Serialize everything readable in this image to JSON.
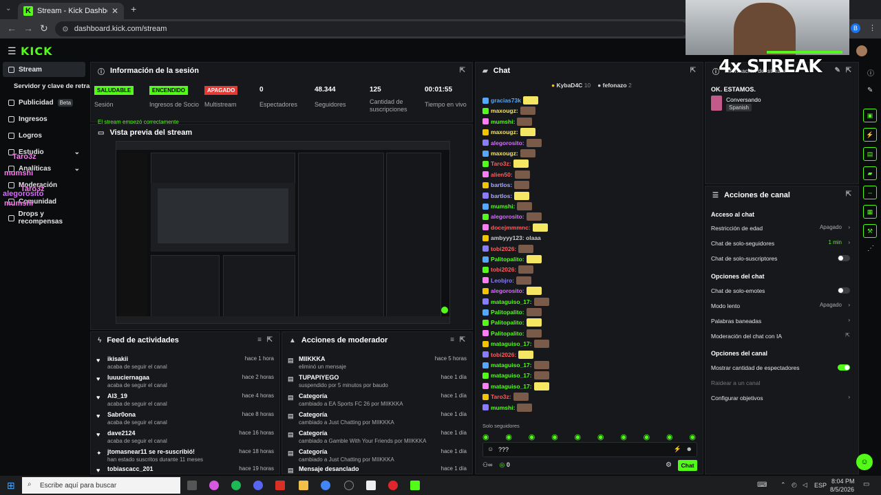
{
  "browser": {
    "tab_title": "Stream - Kick Dashboard",
    "url": "dashboard.kick.com/stream",
    "profile_initial": "B"
  },
  "sidebar": {
    "items": [
      {
        "label": "Stream"
      },
      {
        "label": "Servidor y clave de retransmisión"
      },
      {
        "label": "Publicidad",
        "badge": "Beta"
      },
      {
        "label": "Ingresos"
      },
      {
        "label": "Logros"
      },
      {
        "label": "Estudio"
      },
      {
        "label": "Analíticas"
      },
      {
        "label": "Moderación"
      },
      {
        "label": "Comunidad"
      },
      {
        "label": "Drops y recompensas"
      }
    ]
  },
  "session": {
    "title": "Información de la sesión",
    "stats": [
      {
        "value": "SALUDABLE",
        "label": "Sesión",
        "badge_color": "#53fc18"
      },
      {
        "value": "ENCENDIDO",
        "label": "Ingresos de Socio",
        "badge_color": "#53fc18"
      },
      {
        "value": "APAGADO",
        "label": "Multistream",
        "badge_color": "#e53935"
      },
      {
        "value": "0",
        "label": "Espectadores"
      },
      {
        "value": "48.344",
        "label": "Seguidores"
      },
      {
        "value": "125",
        "label": "Cantidad de suscripciones"
      },
      {
        "value": "00:01:55",
        "label": "Tiempo en vivo"
      }
    ],
    "banner": "El stream empezó correctamente"
  },
  "preview": {
    "title": "Vista previa del stream"
  },
  "feed": {
    "title": "Feed de actividades",
    "rows": [
      {
        "name": "ikisakii",
        "sub": "acaba de seguir el canal",
        "time": "hace 1 hora"
      },
      {
        "name": "luuuciernagaa",
        "sub": "acaba de seguir el canal",
        "time": "hace 2 horas"
      },
      {
        "name": "AI3_19",
        "sub": "acaba de seguir el canal",
        "time": "hace 4 horas"
      },
      {
        "name": "Sabr0ona",
        "sub": "acaba de seguir el canal",
        "time": "hace 8 horas"
      },
      {
        "name": "dave2124",
        "sub": "acaba de seguir el canal",
        "time": "hace 16 horas"
      },
      {
        "name": "jtomasnear11 se re-suscribió!",
        "sub": "han estado suscritos durante 11 meses",
        "time": "hace 18 horas"
      },
      {
        "name": "tobiascacc_201",
        "sub": "",
        "time": "hace 19 horas"
      }
    ]
  },
  "modactions": {
    "title": "Acciones de moderador",
    "rows": [
      {
        "name": "MIIKKKA",
        "sub": "eliminó un mensaje",
        "time": "hace 5 horas"
      },
      {
        "name": "TUPAPIYEGO",
        "sub": "suspendido por 5 minutos por baudo",
        "time": "hace 1 día"
      },
      {
        "name": "Categoría",
        "sub": "cambiado a EA Sports FC 26 por MIIKKKA",
        "time": "hace 1 día"
      },
      {
        "name": "Categoría",
        "sub": "cambiado a Just Chatting por MIIKKKA",
        "time": "hace 1 día"
      },
      {
        "name": "Categoría",
        "sub": "cambiado a Gamble With Your Friends por MIIKKKA",
        "time": "hace 1 día"
      },
      {
        "name": "Categoría",
        "sub": "cambiado a Just Chatting por MIIKKKA",
        "time": "hace 1 día"
      },
      {
        "name": "Mensaje desanclado",
        "sub": "",
        "time": "hace 1 día"
      }
    ]
  },
  "chat": {
    "title": "Chat",
    "pinned_users": [
      {
        "name": "KybaD4C",
        "count": "10"
      },
      {
        "name": "fefonazo",
        "count": "2"
      }
    ],
    "lines": [
      {
        "user": "gracias73k",
        "color": "#53a8ff"
      },
      {
        "user": "maxougz:",
        "color": "#f5e663"
      },
      {
        "user": "mumshi:",
        "color": "#53fc18"
      },
      {
        "user": "maxougz:",
        "color": "#f5e663"
      },
      {
        "user": "alegorosito:",
        "color": "#d770ff"
      },
      {
        "user": "maxougz:",
        "color": "#f5e663"
      },
      {
        "user": "Taro3z:",
        "color": "#ff5e5e"
      },
      {
        "user": "alien50:",
        "color": "#ff5e5e"
      },
      {
        "user": "bartlos:",
        "color": "#aaaaff"
      },
      {
        "user": "bartlos:",
        "color": "#aaaaff"
      },
      {
        "user": "mumshi:",
        "color": "#53fc18"
      },
      {
        "user": "alegorosito:",
        "color": "#d770ff"
      },
      {
        "user": "docejmmmnc:",
        "color": "#ff5e5e"
      },
      {
        "user": "ambyyy123: olaaa",
        "color": "#cccccc"
      },
      {
        "user": "tobi2026:",
        "color": "#ff5e5e"
      },
      {
        "user": "Palitopalito:",
        "color": "#53fc18"
      },
      {
        "user": "tobi2026:",
        "color": "#ff5e5e"
      },
      {
        "user": "Leobjro:",
        "color": "#8a7cff"
      },
      {
        "user": "alegorosito:",
        "color": "#d770ff"
      },
      {
        "user": "mataguiso_17:",
        "color": "#53fc18"
      },
      {
        "user": "Palitopalito:",
        "color": "#53fc18"
      },
      {
        "user": "Palitopalito:",
        "color": "#53fc18"
      },
      {
        "user": "Palitopalito:",
        "color": "#53fc18"
      },
      {
        "user": "mataguiso_17:",
        "color": "#53fc18"
      },
      {
        "user": "tobi2026:",
        "color": "#ff5e5e"
      },
      {
        "user": "mataguiso_17:",
        "color": "#53fc18"
      },
      {
        "user": "mataguiso_17:",
        "color": "#53fc18"
      },
      {
        "user": "mataguiso_17:",
        "color": "#53fc18"
      },
      {
        "user": "Taro3z:",
        "color": "#ff5e5e"
      },
      {
        "user": "mumshi:",
        "color": "#53fc18"
      }
    ],
    "followers_only": "Solo seguidores",
    "input_value": "???",
    "viewer_count": "0",
    "send_label": "Chat"
  },
  "streaminfo": {
    "title": "Información del stream",
    "stream_title": "OK. ESTAMOS.",
    "category": "Conversando",
    "language": "Spanish"
  },
  "actions": {
    "title": "Acciones de canal",
    "chat_access": "Acceso al chat",
    "age_restriction": "Restricción de edad",
    "age_value": "Apagado",
    "followers_only": "Chat de solo-seguidores",
    "followers_value": "1 min",
    "subs_only": "Chat de solo-suscriptores",
    "chat_options": "Opciones del chat",
    "emotes_only": "Chat de solo-emotes",
    "slow_mode": "Modo lento",
    "slow_value": "Apagado",
    "banned_words": "Palabras baneadas",
    "ai_mod": "Moderación del chat con IA",
    "channel_options": "Opciones del canal",
    "show_viewers": "Mostrar cantidad de espectadores",
    "raid": "Raidear a un canal",
    "goals": "Configurar objetivos"
  },
  "overlay": {
    "streak": "4x STREAK",
    "names": [
      "Taro3z",
      "mumshi",
      "Taro3z",
      "alegorosito",
      "Taro3z",
      "mumshi"
    ]
  },
  "taskbar": {
    "search_placeholder": "Escribe aquí para buscar",
    "lang": "ESP",
    "time": "8:04 PM",
    "date": "8/5/2026"
  },
  "colors": {
    "accent": "#53fc18",
    "panel": "#16181b",
    "bg": "#0b0c0d"
  }
}
